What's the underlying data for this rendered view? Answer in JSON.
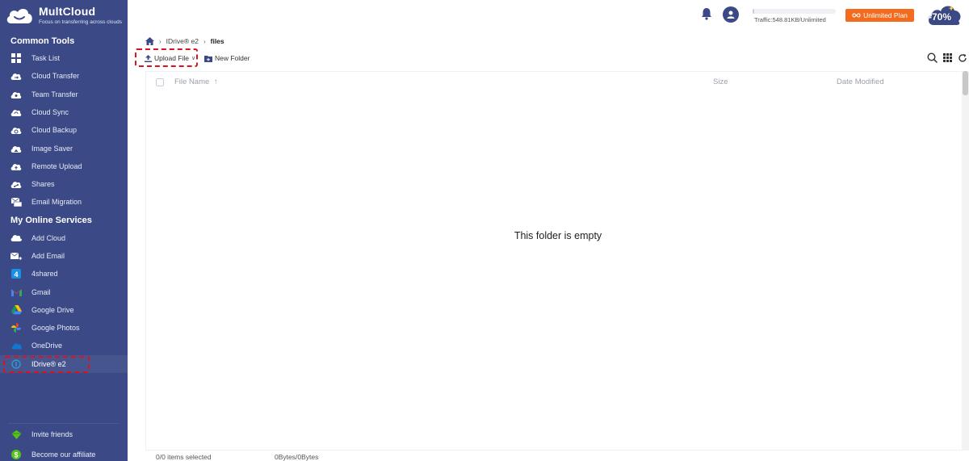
{
  "brand": {
    "title": "MultCloud",
    "subtitle": "Focus on transferring across clouds"
  },
  "sidebar": {
    "common_tools_title": "Common Tools",
    "online_services_title": "My Online Services",
    "common_tools": [
      {
        "label": "Task List",
        "icon": "task-list-icon"
      },
      {
        "label": "Cloud Transfer",
        "icon": "cloud-transfer-icon"
      },
      {
        "label": "Team Transfer",
        "icon": "team-transfer-icon"
      },
      {
        "label": "Cloud Sync",
        "icon": "cloud-sync-icon"
      },
      {
        "label": "Cloud Backup",
        "icon": "cloud-backup-icon"
      },
      {
        "label": "Image Saver",
        "icon": "image-saver-icon"
      },
      {
        "label": "Remote Upload",
        "icon": "remote-upload-icon"
      },
      {
        "label": "Shares",
        "icon": "shares-icon"
      },
      {
        "label": "Email Migration",
        "icon": "email-migration-icon"
      }
    ],
    "online_services": [
      {
        "label": "Add Cloud",
        "icon": "add-cloud-icon"
      },
      {
        "label": "Add Email",
        "icon": "add-email-icon"
      },
      {
        "label": "4shared",
        "icon": "4shared-icon"
      },
      {
        "label": "Gmail",
        "icon": "gmail-icon"
      },
      {
        "label": "Google Drive",
        "icon": "google-drive-icon"
      },
      {
        "label": "Google Photos",
        "icon": "google-photos-icon"
      },
      {
        "label": "OneDrive",
        "icon": "onedrive-icon"
      },
      {
        "label": "IDrive® e2",
        "icon": "idrive-e2-icon",
        "active": true
      }
    ],
    "bottom": [
      {
        "label": "Invite friends",
        "icon": "gift-icon"
      },
      {
        "label": "Become our affiliate",
        "icon": "dollar-icon"
      }
    ]
  },
  "header": {
    "traffic": "Traffic:548.81KB/Unlimited",
    "plan_button": "Unlimited Plan",
    "promo": "-70%"
  },
  "breadcrumb": {
    "root": "IDrive® e2",
    "current": "files"
  },
  "toolbar": {
    "upload": "Upload File",
    "new_folder": "New Folder"
  },
  "table": {
    "col_name": "File Name",
    "col_size": "Size",
    "col_date": "Date Modified",
    "empty_message": "This folder is empty"
  },
  "status": {
    "selected": "0/0 items selected",
    "size": "0Bytes/0Bytes"
  },
  "colors": {
    "sidebar": "#3b4a86",
    "accent_orange": "#f26b1f",
    "highlight_red": "#d8141f"
  }
}
